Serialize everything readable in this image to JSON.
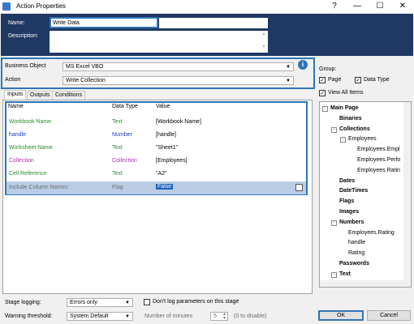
{
  "window": {
    "title": "Action Properties",
    "controls": [
      "?",
      "—",
      "☐",
      "✕"
    ]
  },
  "top": {
    "name_label": "Name:",
    "name_value": "Write Data",
    "description_label": "Description:",
    "description_value": ""
  },
  "business": {
    "object_label": "Business Object",
    "object_value": "MS Excel VBO",
    "action_label": "Action",
    "action_value": "Write Collection"
  },
  "tabs": [
    {
      "label": "Inputs",
      "active": true
    },
    {
      "label": "Outputs",
      "active": false
    },
    {
      "label": "Conditions",
      "active": false
    }
  ],
  "grid": {
    "headers": [
      "Name",
      "Data Type",
      "Value"
    ],
    "rows": [
      {
        "name": "Workbook Name",
        "type": "Text",
        "value": "[Workbook Name]",
        "color": "#2e8b2e"
      },
      {
        "name": "handle",
        "type": "Number",
        "value": "[handle]",
        "color": "#1f3fbf"
      },
      {
        "name": "Worksheet Name",
        "type": "Text",
        "value": "\"Sheet1\"",
        "color": "#2e8b2e"
      },
      {
        "name": "Collection",
        "type": "Collection",
        "value": "[Employees]",
        "color": "#b22db2"
      },
      {
        "name": "Cell Reference",
        "type": "Text",
        "value": "\"A2\"",
        "color": "#2e8b2e"
      },
      {
        "name": "Include Column Names",
        "type": "Flag",
        "value": "False",
        "color": "#7f7f7f"
      }
    ]
  },
  "group": {
    "label": "Group:",
    "page_label": "Page",
    "page_checked": true,
    "datatype_label": "Data Type",
    "datatype_checked": true,
    "viewall_label": "View All Items",
    "viewall_checked": true
  },
  "tree": [
    {
      "label": "Main Page",
      "level": 0,
      "bold": true,
      "exp": "-"
    },
    {
      "label": "Binaries",
      "level": 1,
      "bold": true,
      "exp": ""
    },
    {
      "label": "Collections",
      "level": 1,
      "bold": true,
      "exp": "-"
    },
    {
      "label": "Employees",
      "level": 2,
      "bold": false,
      "exp": "-"
    },
    {
      "label": "Employees.Empl",
      "level": 3,
      "bold": false,
      "exp": ""
    },
    {
      "label": "Employees.Perfo",
      "level": 3,
      "bold": false,
      "exp": ""
    },
    {
      "label": "Employees.Ratin",
      "level": 3,
      "bold": false,
      "exp": ""
    },
    {
      "label": "Dates",
      "level": 1,
      "bold": true,
      "exp": ""
    },
    {
      "label": "DateTimes",
      "level": 1,
      "bold": true,
      "exp": ""
    },
    {
      "label": "Flags",
      "level": 1,
      "bold": true,
      "exp": ""
    },
    {
      "label": "Images",
      "level": 1,
      "bold": true,
      "exp": ""
    },
    {
      "label": "Numbers",
      "level": 1,
      "bold": true,
      "exp": "-"
    },
    {
      "label": "Employees.Rating",
      "level": 2,
      "bold": false,
      "exp": ""
    },
    {
      "label": "handle",
      "level": 2,
      "bold": false,
      "exp": ""
    },
    {
      "label": "Rating",
      "level": 2,
      "bold": false,
      "exp": ""
    },
    {
      "label": "Passwords",
      "level": 1,
      "bold": true,
      "exp": ""
    },
    {
      "label": "Text",
      "level": 1,
      "bold": true,
      "exp": "-"
    }
  ],
  "bottom": {
    "stage_logging_label": "Stage logging:",
    "stage_logging_value": "Errors only",
    "dont_log_label": "Don't log parameters on this stage",
    "warning_label": "Warning threshold:",
    "warning_value": "System Default",
    "minutes_label": "Number of minutes",
    "minutes_value": "5",
    "disable_hint": "(0 to disable)",
    "ok_label": "OK",
    "cancel_label": "Cancel"
  }
}
